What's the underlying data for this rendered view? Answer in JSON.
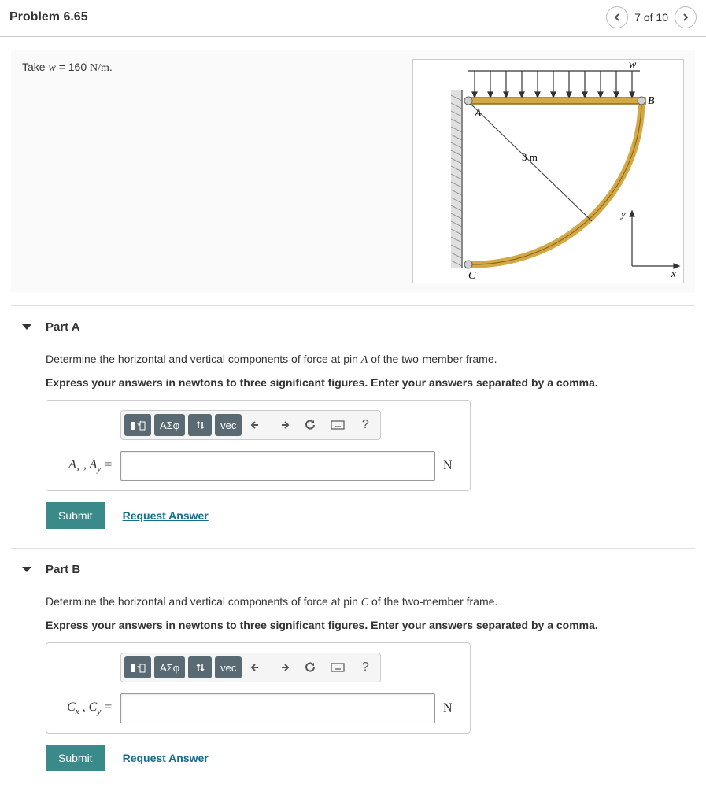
{
  "header": {
    "title": "Problem 6.65",
    "position": "7 of 10"
  },
  "statement": {
    "prefix": "Take ",
    "var": "w",
    "eq": " = 160 ",
    "unit": "N/m",
    "suffix": "."
  },
  "figure": {
    "labels": {
      "A": "A",
      "B": "B",
      "C": "C",
      "w": "w",
      "dim": "3 m",
      "x": "x",
      "y": "y"
    }
  },
  "toolbar": {
    "greek": "ΑΣφ",
    "vec": "vec",
    "help": "?"
  },
  "partA": {
    "title": "Part A",
    "instr_pre": "Determine the horizontal and vertical components of force at pin ",
    "instr_var": "A",
    "instr_post": " of the two-member frame.",
    "bold": "Express your answers in newtons to three significant figures. Enter your answers separated by a comma.",
    "lhs_html": "A_x , A_y =",
    "unit": "N",
    "submit": "Submit",
    "request": "Request Answer"
  },
  "partB": {
    "title": "Part B",
    "instr_pre": "Determine the horizontal and vertical components of force at pin ",
    "instr_var": "C",
    "instr_post": " of the two-member frame.",
    "bold": "Express your answers in newtons to three significant figures. Enter your answers separated by a comma.",
    "lhs_html": "C_x , C_y =",
    "unit": "N",
    "submit": "Submit",
    "request": "Request Answer"
  }
}
